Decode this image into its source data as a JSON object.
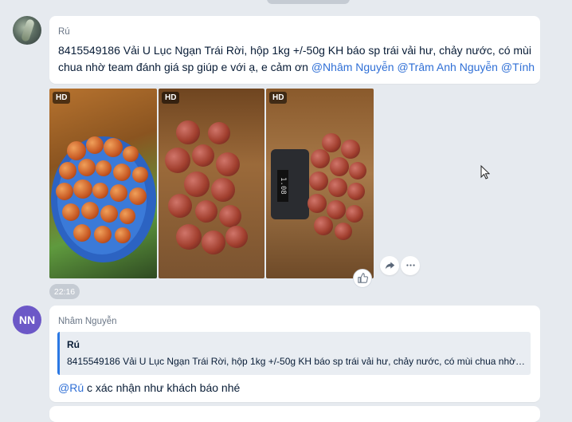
{
  "message_1": {
    "sender": "Rú",
    "text": "8415549186 Vải U Lục Ngạn Trái Rời, hộp 1kg +/-50g KH báo sp trái vải hư, chảy nước, có mùi",
    "text_line2": "chua nhờ team đánh giá sp giúp e với ạ, e cảm ơn",
    "mentions": [
      "@Nhâm Nguyễn",
      "@Trâm Anh Nguyễn",
      "@Tính"
    ],
    "images": [
      {
        "badge": "HD",
        "icon": "photo-icon"
      },
      {
        "badge": "HD",
        "icon": "photo-icon"
      },
      {
        "badge": "HD",
        "icon": "photo-icon"
      }
    ],
    "time": "22:16",
    "scale_reading": "1.08"
  },
  "message_2": {
    "avatar_initials": "NN",
    "sender": "Nhâm Nguyễn",
    "quote": {
      "sender": "Rú",
      "text": "8415549186 Vải U Lục Ngạn Trái Rời, hộp 1kg +/-50g KH báo sp trái vải hư, chảy nước, có mùi chua nhờ team..."
    },
    "reply_mention": "@Rú",
    "reply_text": " c xác nhận như khách báo nhé"
  },
  "icons": {
    "like": "thumbs-up-icon",
    "share": "share-arrow-icon",
    "more": "more-dots-icon",
    "cursor": "mouse-cursor-icon"
  },
  "colors": {
    "background": "#e6eaef",
    "mention": "#2f6fd6",
    "quote_bar": "#2b78e4",
    "avatar_nn": "#6c58c7"
  }
}
